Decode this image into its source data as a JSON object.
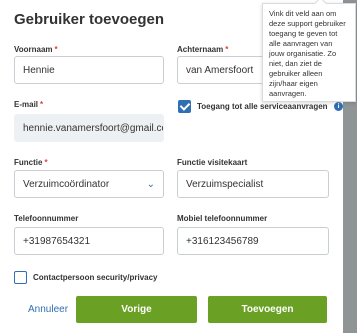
{
  "modal": {
    "title": "Gebruiker toevoegen"
  },
  "tooltip": {
    "text": "Vink dit veld aan om deze support gebruiker toegang te geven tot alle aanvragen van jouw organisatie. Zo niet, dan ziet de gebruiker alleen zijn/haar eigen aanvragen."
  },
  "fields": {
    "voornaam": {
      "label": "Voornaam",
      "required": "*",
      "value": "Hennie"
    },
    "achternaam": {
      "label": "Achternaam",
      "required": "*",
      "value": "van Amersfoort"
    },
    "email": {
      "label": "E-mail",
      "required": "*",
      "value": "hennie.vanamersfoort@gmail.com"
    },
    "toegang": {
      "label": "Toegang tot alle serviceaanvragen",
      "checked": true
    },
    "functie": {
      "label": "Functie",
      "required": "*",
      "value": "Verzuimcoördinator"
    },
    "functie_visitekaart": {
      "label": "Functie visitekaart",
      "value": "Verzuimspecialist"
    },
    "telefoon": {
      "label": "Telefoonnummer",
      "value": "+31987654321"
    },
    "mobiel": {
      "label": "Mobiel telefoonnummer",
      "value": "+316123456789"
    },
    "contactpersoon": {
      "label": "Contactpersoon security/privacy",
      "checked": false
    }
  },
  "actions": {
    "cancel": "Annuleer",
    "previous": "Vorige",
    "add": "Toevoegen"
  },
  "colors": {
    "accent": "#2f6fb3",
    "primary_button": "#6aa023",
    "required": "#e63b3b"
  },
  "icons": {
    "close": "close-icon",
    "info": "info-icon",
    "dropdown": "chevron-down-icon"
  }
}
